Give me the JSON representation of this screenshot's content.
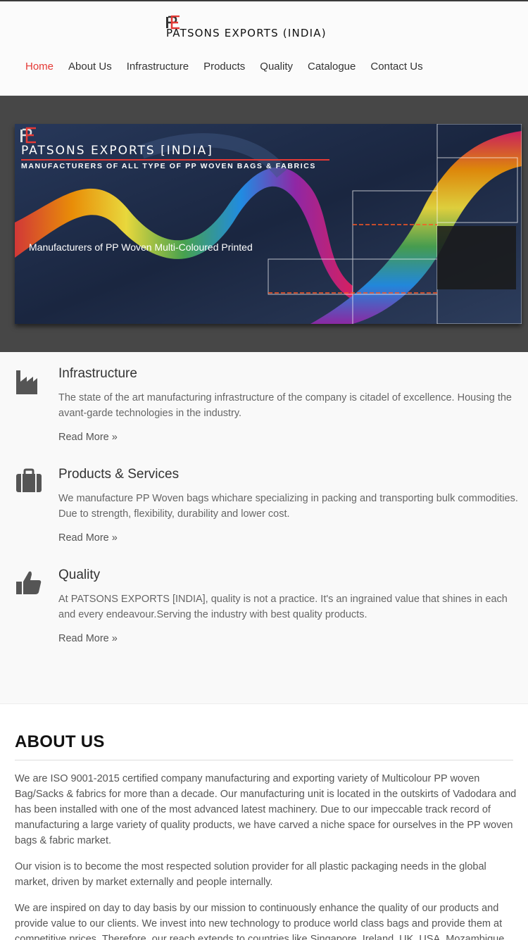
{
  "brand": {
    "name": "PATSONS EXPORTS (INDIA)",
    "accent_color": "#e53935"
  },
  "nav": {
    "items": [
      {
        "label": "Home",
        "active": true
      },
      {
        "label": "About Us"
      },
      {
        "label": "Infrastructure"
      },
      {
        "label": "Products"
      },
      {
        "label": "Quality"
      },
      {
        "label": "Catalogue"
      },
      {
        "label": "Contact Us"
      }
    ]
  },
  "slider": {
    "brand": "PATSONS EXPORTS [INDIA]",
    "tagline": "MANUFACTURERS OF ALL TYPE OF PP WOVEN BAGS & FABRICS",
    "caption": "Manufacturers of PP Woven Multi-Coloured Printed"
  },
  "features": [
    {
      "icon": "factory-icon",
      "title": "Infrastructure",
      "text": "The state of the art manufacturing infrastructure of the company is citadel of excellence. Housing the avant-garde technologies in the industry.",
      "link": "Read More »"
    },
    {
      "icon": "briefcase-icon",
      "title": "Products & Services",
      "text": "We manufacture PP Woven bags whichare specializing in packing and transporting bulk commodities. Due to strength, flexibility, durability and lower cost.",
      "link": "Read More »"
    },
    {
      "icon": "thumbs-up-icon",
      "title": "Quality",
      "text": "At PATSONS EXPORTS [INDIA], quality is not a practice. It's an ingrained value that shines in each and every endeavour.Serving the industry with best quality products.",
      "link": "Read More »"
    }
  ],
  "about": {
    "heading": "ABOUT US",
    "paragraphs": [
      "We are ISO 9001-2015 certified company manufacturing and exporting variety of Multicolour PP woven Bag/Sacks & fabrics for more than a decade. Our manufacturing unit is located in the outskirts of Vadodara and has been installed with one of the most advanced latest machinery. Due to our impeccable track record of manufacturing a large variety of quality products, we have carved a niche space for ourselves in the PP woven bags & fabric market.",
      "Our vision is to become the most respected solution provider for all plastic packaging needs in the global market, driven by market externally and people internally.",
      "We are inspired on day to day basis by our mission to continuously enhance the quality of our products and provide value to our clients. We invest into new technology to produce world class bags and provide them at competitive prices. Therefore, our reach extends to countries like Singapore, Ireland, UK, USA, Mozambique"
    ]
  }
}
